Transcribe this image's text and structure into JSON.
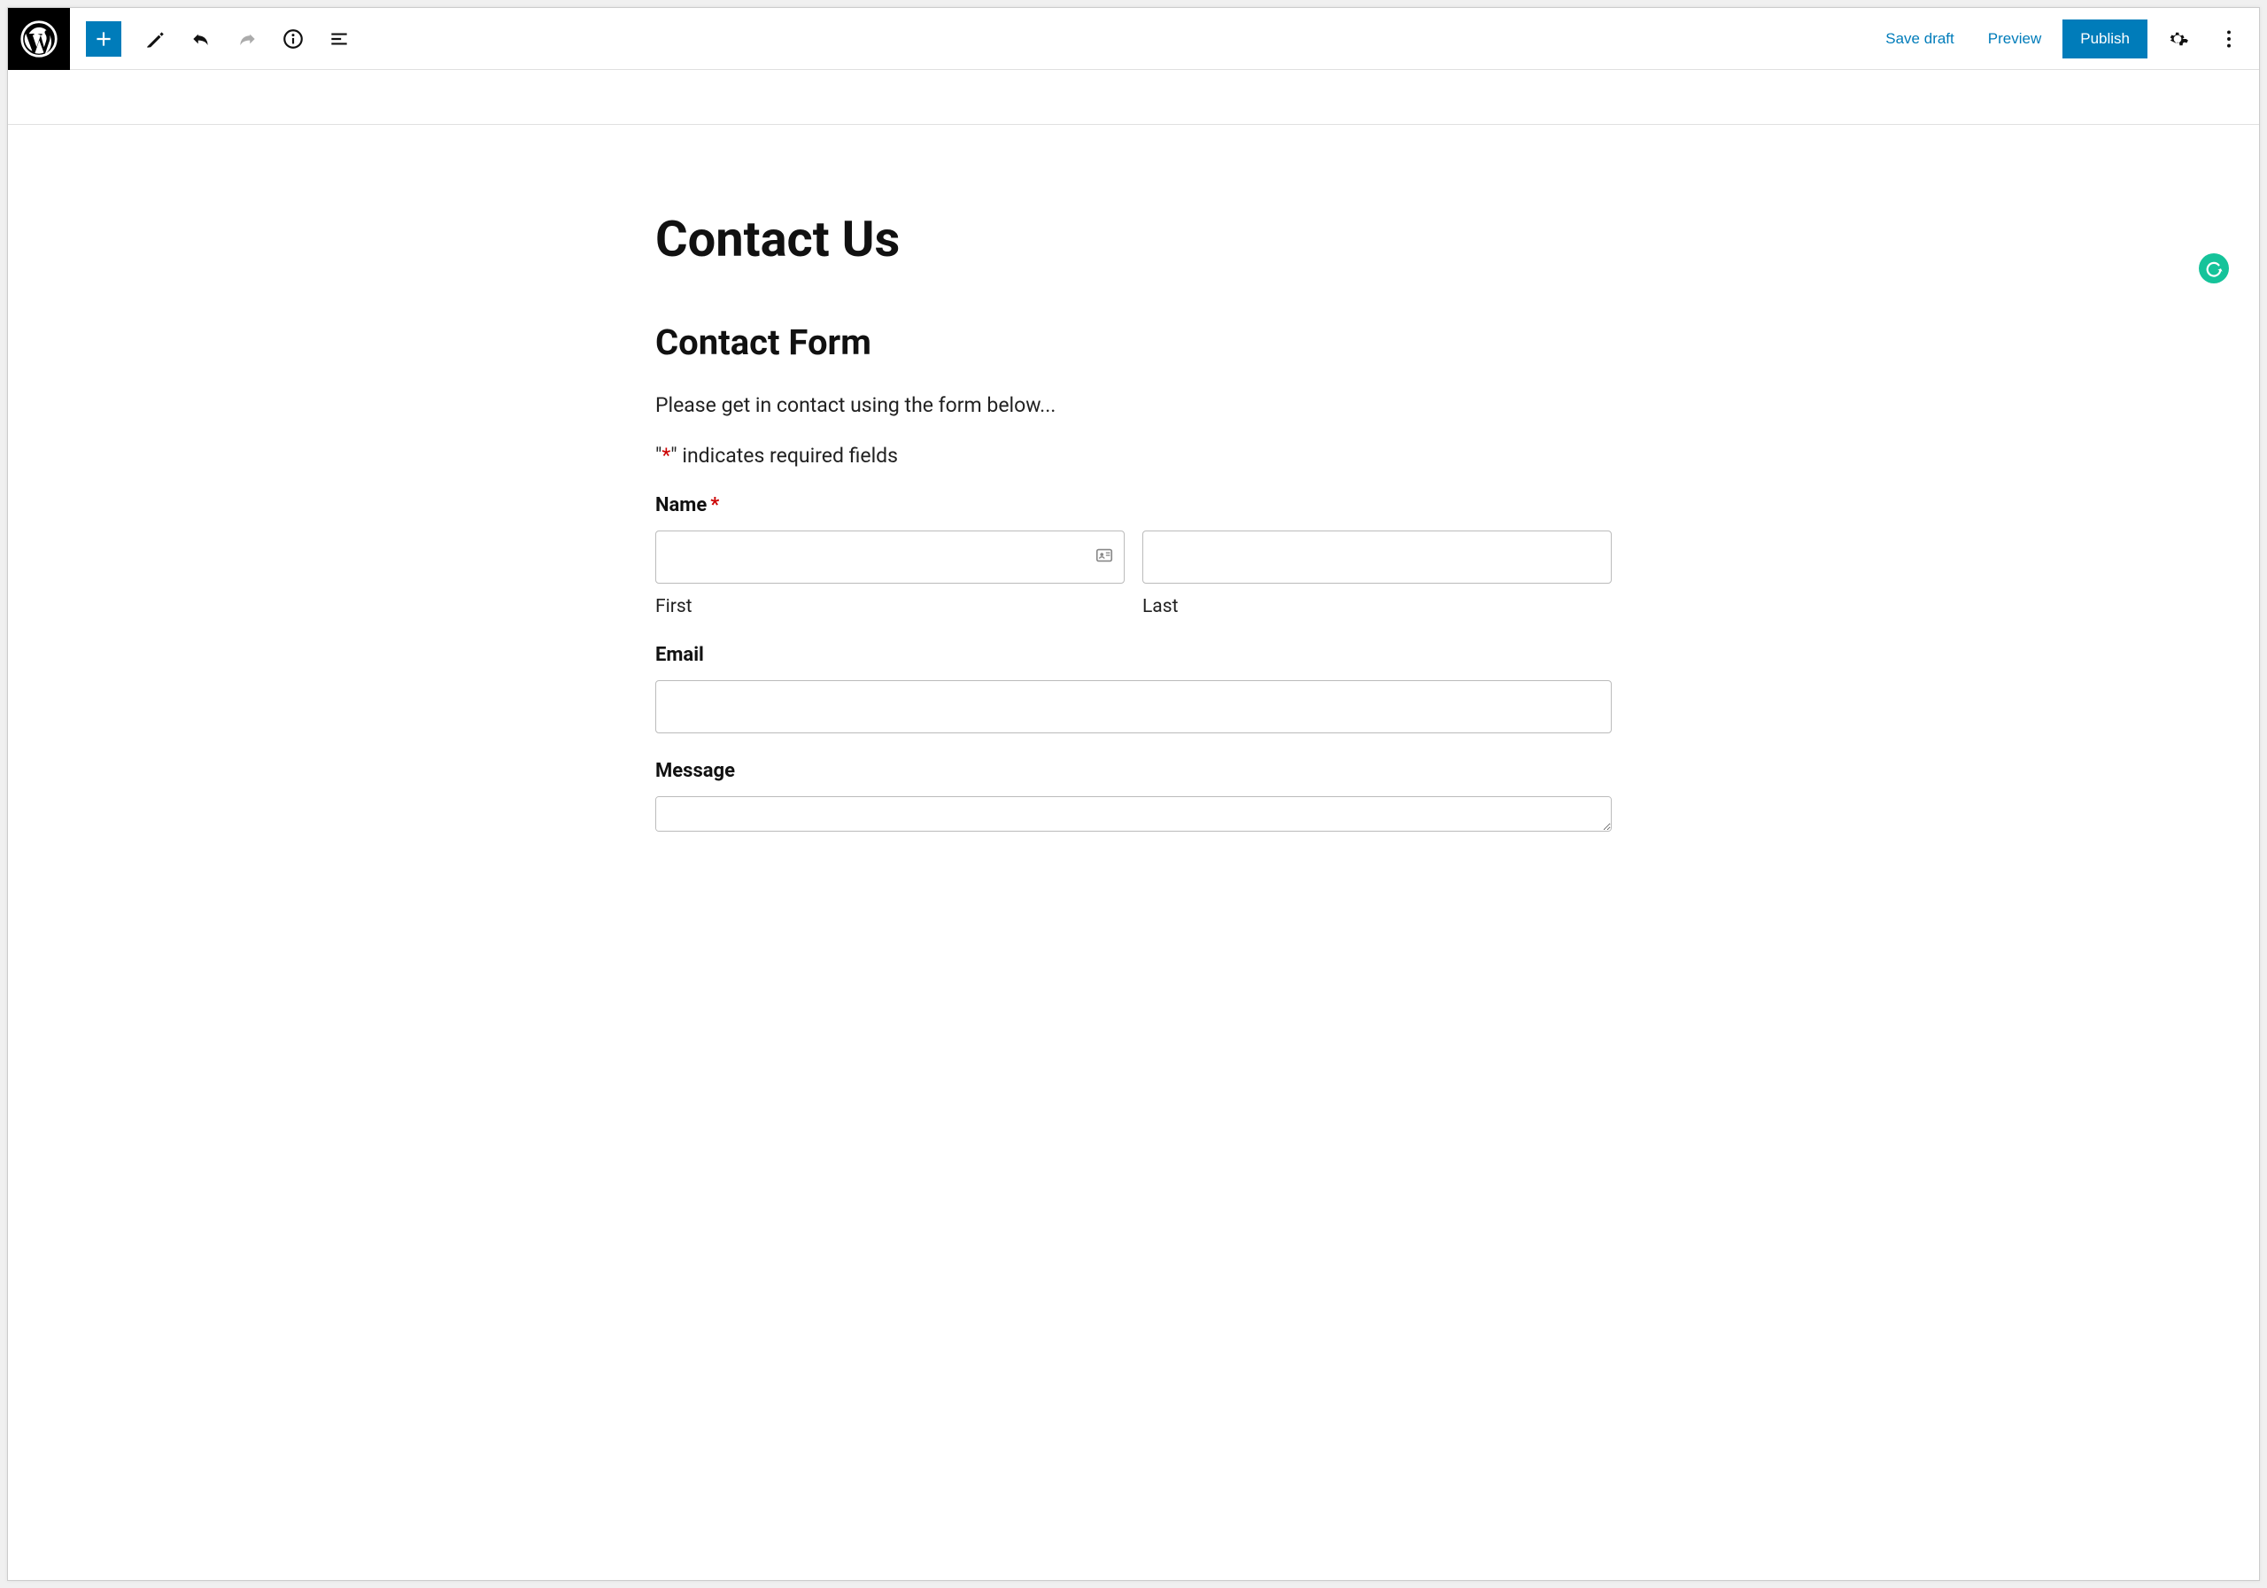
{
  "toolbar": {
    "save_draft": "Save draft",
    "preview": "Preview",
    "publish": "Publish"
  },
  "page": {
    "title": "Contact Us",
    "form_heading": "Contact Form",
    "intro": "Please get in contact using the form below...",
    "required_left": "\"",
    "required_star": "*",
    "required_right": "\" indicates required fields"
  },
  "fields": {
    "name": {
      "label": "Name",
      "required_mark": "*",
      "first_sub": "First",
      "last_sub": "Last"
    },
    "email": {
      "label": "Email"
    },
    "message": {
      "label": "Message"
    }
  }
}
